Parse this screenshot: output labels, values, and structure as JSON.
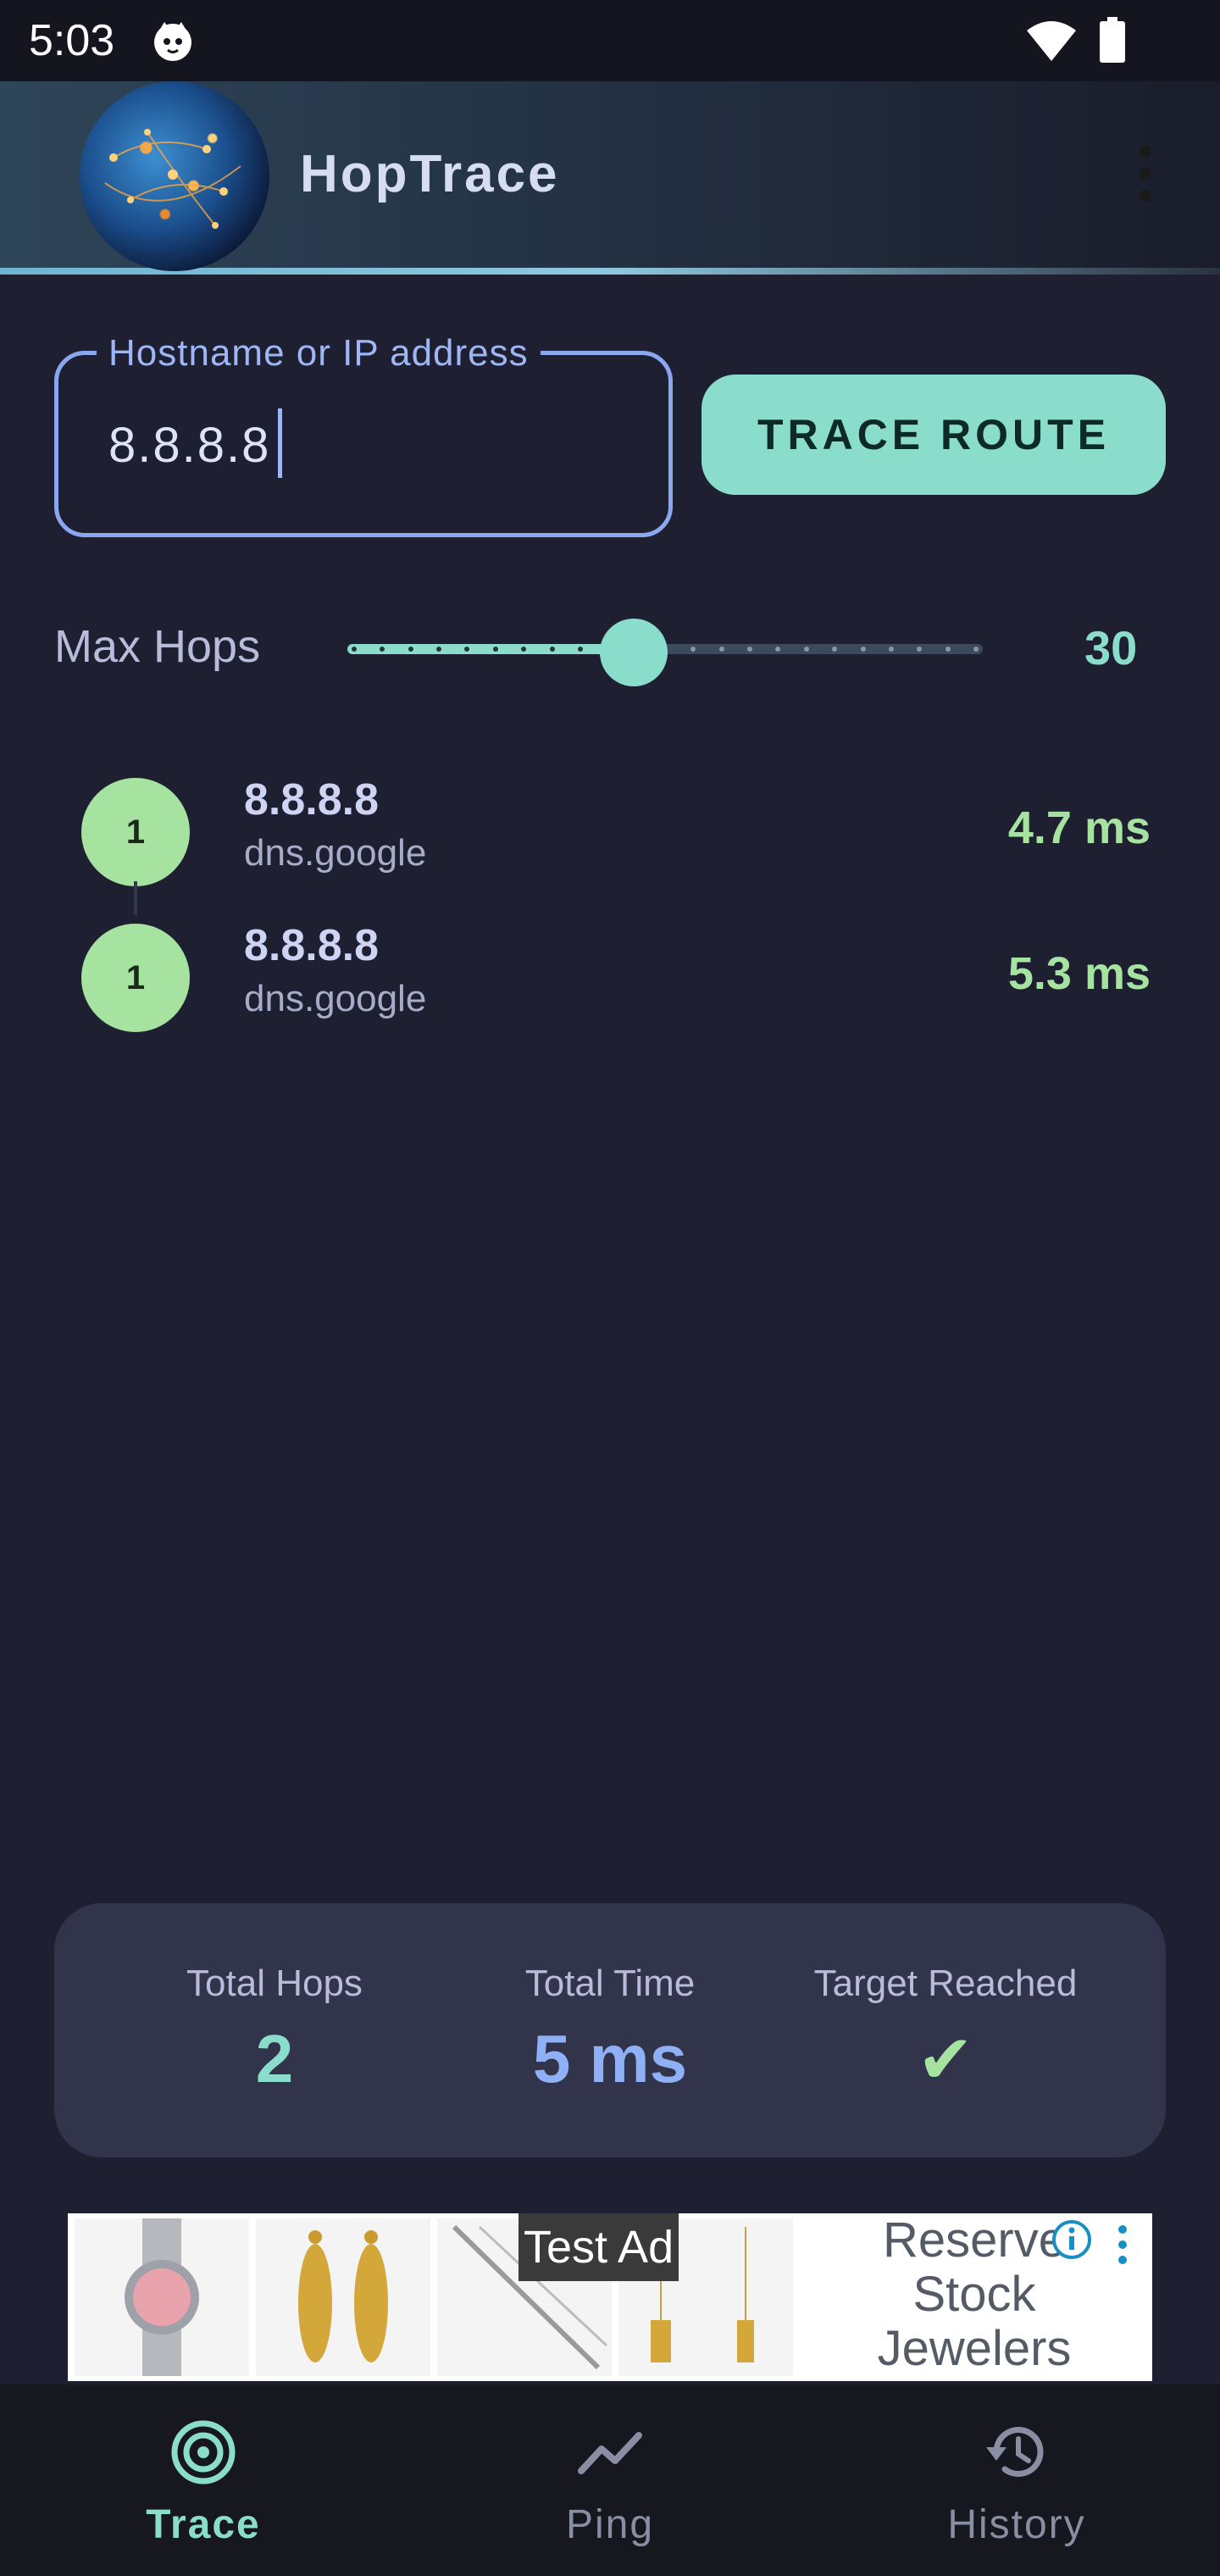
{
  "status_bar": {
    "time": "5:03"
  },
  "app_bar": {
    "title": "HopTrace"
  },
  "host_input": {
    "label": "Hostname or IP address",
    "value": "8.8.8.8"
  },
  "trace_button": {
    "label": "TRACE ROUTE"
  },
  "max_hops": {
    "label": "Max Hops",
    "value": "30",
    "fraction": 0.45
  },
  "hops": [
    {
      "number": "1",
      "ip": "8.8.8.8",
      "host": "dns.google",
      "time": "4.7 ms"
    },
    {
      "number": "1",
      "ip": "8.8.8.8",
      "host": "dns.google",
      "time": "5.3 ms"
    }
  ],
  "summary": {
    "total_hops_label": "Total Hops",
    "total_hops": "2",
    "total_time_label": "Total Time",
    "total_time": "5 ms",
    "target_reached_label": "Target Reached",
    "target_reached": "✔"
  },
  "ad": {
    "label": "Test Ad",
    "line1": "Reserve",
    "line2": "Stock",
    "line3": "Jewelers"
  },
  "bottom_nav": [
    {
      "label": "Trace",
      "icon": "target-icon",
      "active": true
    },
    {
      "label": "Ping",
      "icon": "trend-icon",
      "active": false
    },
    {
      "label": "History",
      "icon": "history-icon",
      "active": false
    }
  ],
  "colors": {
    "accent": "#8adccb",
    "success": "#a6e3a1",
    "time_blue": "#8fb0f5",
    "background": "#1e1f30"
  }
}
